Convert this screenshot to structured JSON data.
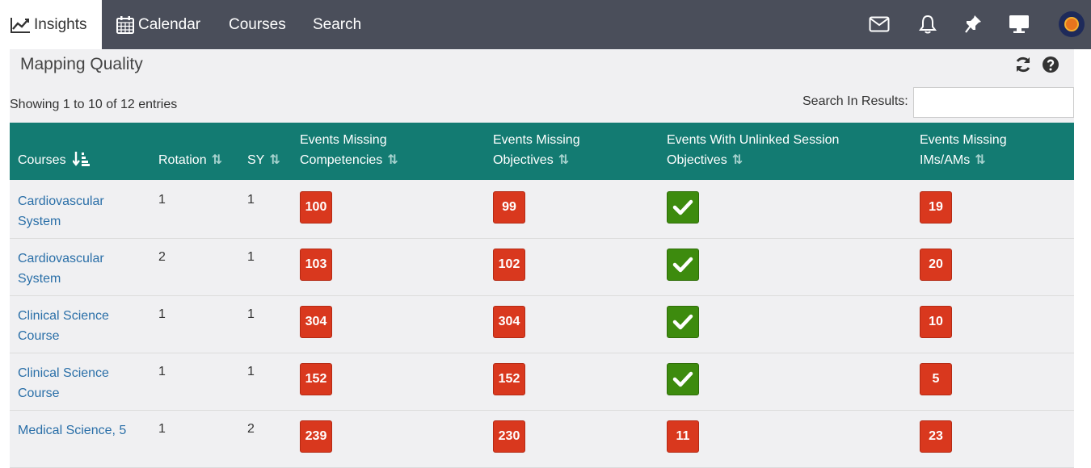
{
  "nav": {
    "insights": "Insights",
    "calendar": "Calendar",
    "courses": "Courses",
    "search": "Search"
  },
  "panel": {
    "title": "Mapping Quality",
    "info": "Showing 1 to 10 of 12 entries",
    "search_label": "Search In Results:"
  },
  "table": {
    "headers": {
      "courses": "Courses",
      "rotation": "Rotation",
      "sy": "SY",
      "missing_comp_1": "Events Missing",
      "missing_comp_2": "Competencies",
      "missing_obj_1": "Events Missing",
      "missing_obj_2": "Objectives",
      "unlinked_1": "Events With Unlinked Session",
      "unlinked_2": "Objectives",
      "missing_ims_1": "Events Missing",
      "missing_ims_2": "IMs/AMs"
    },
    "rows": [
      {
        "course": "Cardiovascular System",
        "rotation": "1",
        "sy": "1",
        "comp": "100",
        "obj": "99",
        "unlinked": "",
        "ims": "19"
      },
      {
        "course": "Cardiovascular System",
        "rotation": "2",
        "sy": "1",
        "comp": "103",
        "obj": "102",
        "unlinked": "",
        "ims": "20"
      },
      {
        "course": "Clinical Science Course",
        "rotation": "1",
        "sy": "1",
        "comp": "304",
        "obj": "304",
        "unlinked": "",
        "ims": "10"
      },
      {
        "course": "Clinical Science Course",
        "rotation": "1",
        "sy": "1",
        "comp": "152",
        "obj": "152",
        "unlinked": "",
        "ims": "5"
      },
      {
        "course": "Medical Science, 5",
        "rotation": "1",
        "sy": "2",
        "comp": "239",
        "obj": "230",
        "unlinked": "11",
        "ims": "23"
      }
    ]
  },
  "colors": {
    "nav_bg": "#4a4e5a",
    "header_bg": "#137b72",
    "badge_red": "#d9381e",
    "badge_green": "#3d8b0e",
    "link": "#2a6fa8"
  }
}
